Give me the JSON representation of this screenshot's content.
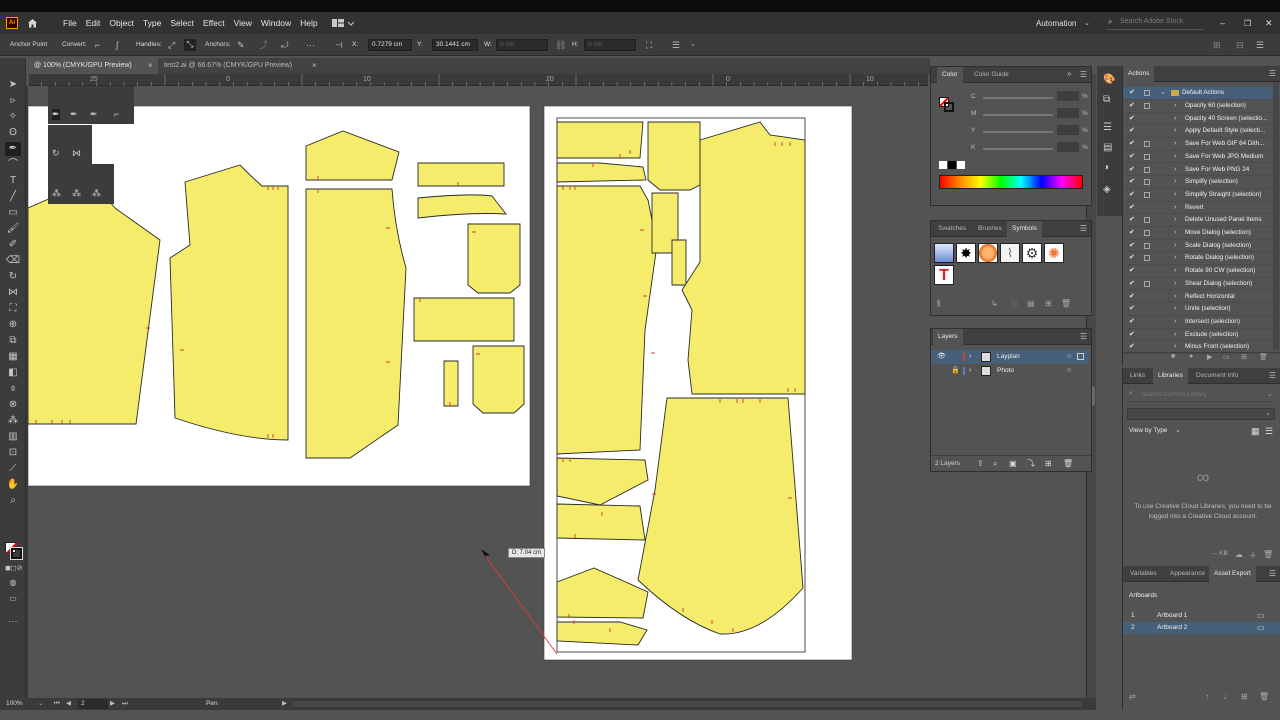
{
  "app": {
    "logo": "Ai"
  },
  "menu": [
    "File",
    "Edit",
    "Object",
    "Type",
    "Select",
    "Effect",
    "View",
    "Window",
    "Help"
  ],
  "workspace": "Automation",
  "search": {
    "placeholder": "Search Adobe Stock"
  },
  "control": {
    "mode": "Anchor Point",
    "convert": "Convert:",
    "handles": "Handles:",
    "anchors": "Anchors:",
    "x_label": "X:",
    "x_value": "0.7279 cm",
    "y_label": "Y:",
    "y_value": "30.1441 cm",
    "w_label": "W:",
    "w_value": "0 cm",
    "h_label": "H:",
    "h_value": "0 cm"
  },
  "tabs": [
    {
      "label": "@ 100% (CMYK/GPU Preview)",
      "close": "×"
    },
    {
      "label": "test2.ai @ 66.67% (CMYK/GPU Preview)",
      "close": "×"
    }
  ],
  "ruler": [
    "25",
    "0",
    "10",
    "20",
    "0",
    "10",
    "20"
  ],
  "measure_tooltip": "D: 7.04 cm",
  "status": {
    "zoom": "100%",
    "artboard": "2",
    "tool": "Pen"
  },
  "color_panel": {
    "tabs": [
      "Color",
      "Color Guide"
    ],
    "channels": [
      "C",
      "M",
      "Y",
      "K"
    ],
    "unit": "%"
  },
  "symbols_panel": {
    "tabs": [
      "Swatches",
      "Brushes",
      "Symbols"
    ]
  },
  "layers_panel": {
    "title": "Layers",
    "layers": [
      {
        "name": "Layplan"
      },
      {
        "name": "Photo"
      }
    ],
    "count": "2 Layers"
  },
  "actions_panel": {
    "title": "Actions",
    "set": "Default Actions",
    "items": [
      "Opacity 60 (selection)",
      "Opacity 40 Screen (selectio...",
      "Apply Default Style (selecti...",
      "Save For Web GIF 64 Dith...",
      "Save For Web JPG Medium",
      "Save For Web PNG 24",
      "Simplify (selection)",
      "Simplify Straight (selection)",
      "Revert",
      "Delete Unused Panel Items",
      "Move Dialog (selection)",
      "Scale Dialog (selection)",
      "Rotate Dialog (selection)",
      "Rotate 90 CW (selection)",
      "Shear Dialog (selection)",
      "Reflect Horizontal",
      "Unite (selection)",
      "Intersect (selection)",
      "Exclude (selection)",
      "Minus Front (selection)"
    ]
  },
  "libraries_panel": {
    "tabs": [
      "Links",
      "Libraries",
      "Document Info"
    ],
    "search_placeholder": "Search Current Library",
    "view_by": "View by Type",
    "message": "To use Creative Cloud Libraries, you need to be logged into a Creative Cloud account.",
    "size": "-- KB"
  },
  "asset_panel": {
    "tabs": [
      "Variables",
      "Appearance",
      "Asset Export"
    ],
    "title": "Artboards",
    "artboards": [
      {
        "num": "1",
        "name": "Artboard 1"
      },
      {
        "num": "2",
        "name": "Artboard 2"
      }
    ]
  },
  "colors": {
    "accent": "#46607a",
    "pattern_fill": "#f4ec6a",
    "pattern_stroke": "#2a2a2a"
  }
}
